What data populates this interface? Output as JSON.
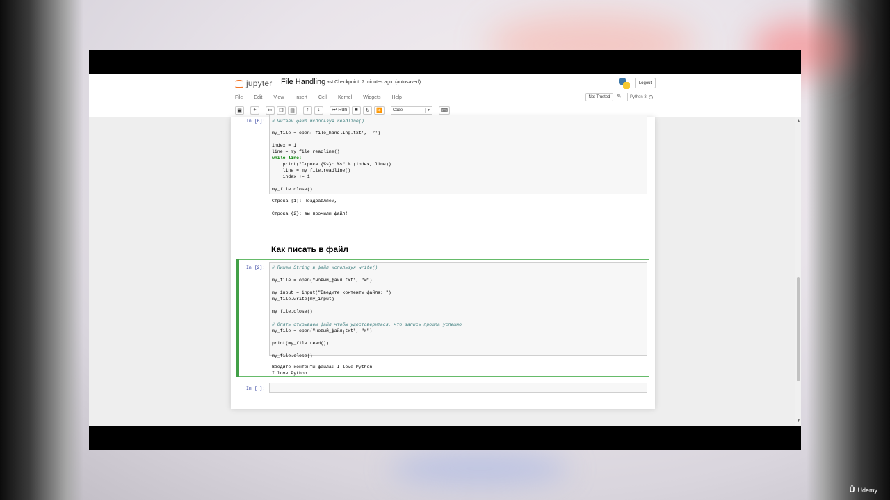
{
  "header": {
    "logo_text": "jupyter",
    "notebook_title": "File Handling",
    "checkpoint": "Last Checkpoint: 7 minutes ago",
    "autosave": "(autosaved)",
    "logout_label": "Logout"
  },
  "menubar": {
    "items": [
      "File",
      "Edit",
      "View",
      "Insert",
      "Cell",
      "Kernel",
      "Widgets",
      "Help"
    ],
    "trust_label": "Not Trusted",
    "kernel_name": "Python 3"
  },
  "toolbar": {
    "run_label": "Run",
    "cell_type": "Code"
  },
  "cells": {
    "cell1": {
      "prompt": "In [6]:",
      "lines": [
        "# Читаем файл используя readline()",
        "my_file = open('file_handling.txt', 'r')",
        "index = 1",
        "line = my_file.readline()",
        "while line:",
        "    print(\"Строка {%s}: %s\" % (index, line))",
        "    line = my_file.readline()",
        "    index += 1",
        "my_file.close()"
      ],
      "outputs": [
        "Строка {1}: Поздравляем,",
        "Строка {2}: вы прочили файл!"
      ]
    },
    "markdown": {
      "heading": "Как писать в файл"
    },
    "cell2": {
      "prompt": "In [2]:",
      "lines": [
        "# Пишем String в файл используя write()",
        "my_file = open(\"новый_файл.txt\", \"w\")",
        "my_input = input(\"Введите контенты файла: \")",
        "my_file.write(my_input)",
        "my_file.close()",
        "# Опять открываем файл чтобы удостовериться, что запись прошла успешно",
        "my_file = open(\"новый_файл.txt\", \"r\")",
        "print(my_file.read())",
        "my_file.close()"
      ],
      "outputs": [
        "Введите контенты файла: I love Python",
        "I love Python"
      ]
    },
    "cell3": {
      "prompt": "In [ ]:"
    }
  },
  "watermark": "Udemy",
  "colors": {
    "jupyter_orange": "#f37626",
    "selected_green": "#42a047",
    "prompt_blue": "#303f9f"
  }
}
